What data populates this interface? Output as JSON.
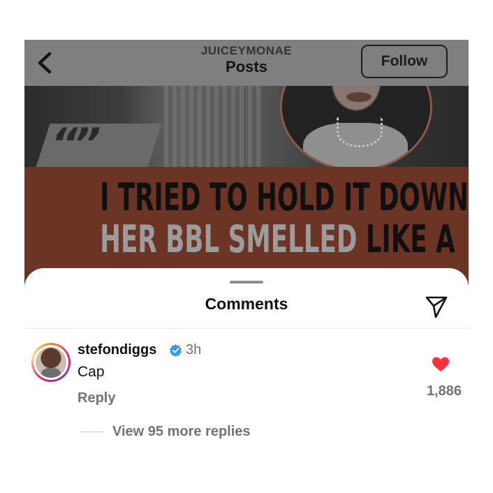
{
  "header": {
    "username": "JUICEYMONAE",
    "title": "Posts",
    "follow_label": "Follow",
    "icons": {
      "back": "chevron-left-icon"
    }
  },
  "post": {
    "quote_glyph": "“”",
    "headline_line1": "I TRIED TO HOLD IT DOWN, BUT",
    "headline_line2_gray": "HER BBL SMELLED",
    "headline_line2_dark": " LIKE A"
  },
  "comments_sheet": {
    "title": "Comments",
    "icons": {
      "share": "paper-plane-icon"
    },
    "comment": {
      "username": "stefondiggs",
      "verified": true,
      "time": "3h",
      "text": "Cap",
      "reply_label": "Reply",
      "likes": "1,886",
      "liked": true,
      "view_replies_label": "View 95 more replies"
    }
  },
  "colors": {
    "overlay_dim": "#7f7f7f",
    "verified_blue": "#3897f0",
    "heart_red": "#ff3040",
    "secondary_text": "#737373"
  }
}
